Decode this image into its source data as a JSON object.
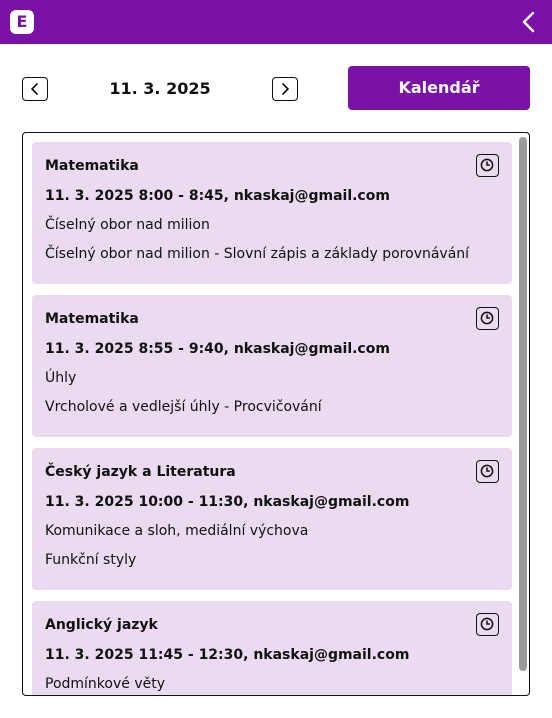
{
  "header": {
    "logo_letter": "E",
    "bg_color": "#7b12a8"
  },
  "nav": {
    "date": "11. 3. 2025",
    "calendar_label": "Kalendář"
  },
  "lessons": [
    {
      "subject": "Matematika",
      "time": "11. 3. 2025 8:00 - 8:45, nkaskaj@gmail.com",
      "topic": "Číselný obor nad milion",
      "detail": "Číselný obor nad milion - Slovní zápis a základy porovnávání"
    },
    {
      "subject": "Matematika",
      "time": "11. 3. 2025 8:55 - 9:40, nkaskaj@gmail.com",
      "topic": "Úhly",
      "detail": "Vrcholové a vedlejší úhly - Procvičování"
    },
    {
      "subject": "Český jazyk a Literatura",
      "time": "11. 3. 2025 10:00 - 11:30, nkaskaj@gmail.com",
      "topic": "Komunikace a sloh, mediální výchova",
      "detail": "Funkční styly"
    },
    {
      "subject": "Anglický jazyk",
      "time": "11. 3. 2025 11:45 - 12:30, nkaskaj@gmail.com",
      "topic": "Podmínkové věty",
      "detail": ""
    }
  ]
}
